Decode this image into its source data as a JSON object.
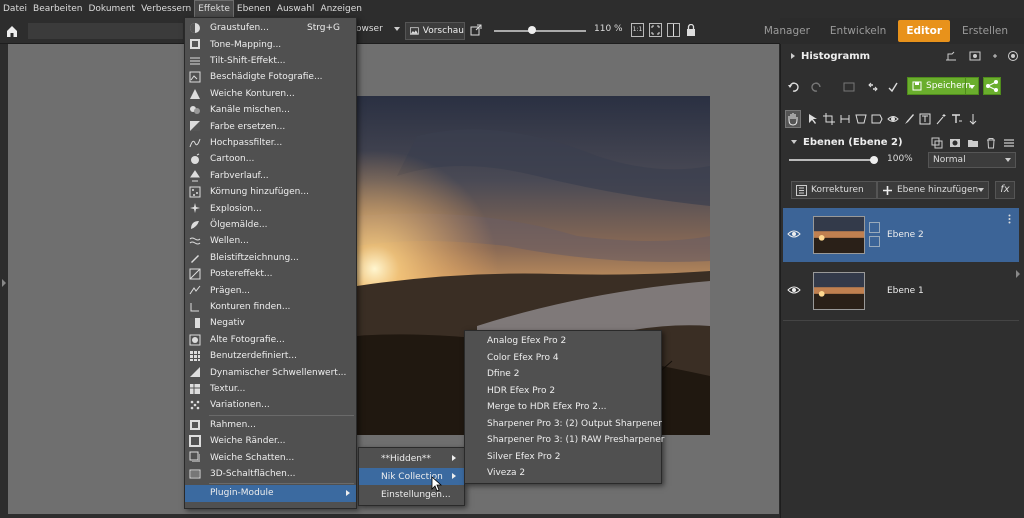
{
  "menubar": [
    "Datei",
    "Bearbeiten",
    "Dokument",
    "Verbessern",
    "Effekte",
    "Ebenen",
    "Auswahl",
    "Anzeigen"
  ],
  "menubar_active": "Effekte",
  "modes": [
    "Manager",
    "Entwickeln",
    "Editor",
    "Erstellen"
  ],
  "mode_active": "Editor",
  "toolbar": {
    "browser_label": "owser",
    "preview_label": "Vorschau",
    "zoom": "110 %",
    "fit_1_1": "1:1"
  },
  "effects_menu": {
    "items": [
      {
        "label": "Graustufen...",
        "shortcut": "Strg+G",
        "icon": "grayscale-icon"
      },
      {
        "label": "Tone-Mapping...",
        "icon": "tone-mapping-icon"
      },
      {
        "label": "Tilt-Shift-Effekt...",
        "icon": "tilt-shift-icon"
      },
      {
        "label": "Beschädigte Fotografie...",
        "icon": "damaged-photo-icon"
      },
      {
        "label": "Weiche Konturen...",
        "icon": "soft-contours-icon"
      },
      {
        "label": "Kanäle mischen...",
        "icon": "channel-mixer-icon"
      },
      {
        "label": "Farbe ersetzen...",
        "icon": "replace-color-icon"
      },
      {
        "label": "Hochpassfilter...",
        "icon": "highpass-icon"
      },
      {
        "label": "Cartoon...",
        "icon": "cartoon-icon"
      },
      {
        "label": "Farbverlauf...",
        "icon": "gradient-icon"
      },
      {
        "label": "Körnung hinzufügen...",
        "icon": "grain-icon"
      },
      {
        "label": "Explosion...",
        "icon": "explosion-icon"
      },
      {
        "label": "Ölgemälde...",
        "icon": "oil-painting-icon"
      },
      {
        "label": "Wellen...",
        "icon": "waves-icon"
      },
      {
        "label": "Bleistiftzeichnung...",
        "icon": "pencil-icon"
      },
      {
        "label": "Postereffekt...",
        "icon": "poster-icon"
      },
      {
        "label": "Prägen...",
        "icon": "emboss-icon"
      },
      {
        "label": "Konturen finden...",
        "icon": "find-edges-icon"
      },
      {
        "label": "Negativ",
        "icon": "negative-icon"
      },
      {
        "label": "Alte Fotografie...",
        "icon": "old-photo-icon"
      },
      {
        "label": "Benutzerdefiniert...",
        "icon": "custom-icon"
      },
      {
        "label": "Dynamischer Schwellenwert...",
        "icon": "threshold-icon"
      },
      {
        "label": "Textur...",
        "icon": "texture-icon"
      },
      {
        "label": "Variationen...",
        "icon": "variations-icon"
      },
      {
        "label": "Rahmen...",
        "icon": "frame-icon"
      },
      {
        "label": "Weiche Ränder...",
        "icon": "soft-edges-icon"
      },
      {
        "label": "Weiche Schatten...",
        "icon": "soft-shadow-icon"
      },
      {
        "label": "3D-Schaltflächen...",
        "icon": "3d-button-icon"
      },
      {
        "label": "Plugin-Module",
        "icon": "",
        "submenu": true,
        "highlighted": true
      }
    ]
  },
  "plugin_menu": {
    "items": [
      {
        "label": "**Hidden**",
        "submenu": true
      },
      {
        "label": "Nik Collection",
        "submenu": true,
        "highlighted": true
      },
      {
        "label": "Einstellungen..."
      }
    ]
  },
  "nik_menu": {
    "items": [
      "Analog Efex Pro 2",
      "Color Efex Pro 4",
      "Dfine 2",
      "HDR Efex Pro 2",
      "Merge to HDR Efex Pro 2...",
      "Sharpener Pro 3: (2) Output Sharpener",
      "Sharpener Pro 3: (1) RAW Presharpener",
      "Silver Efex Pro 2",
      "Viveza 2"
    ]
  },
  "right_panel": {
    "histogram_title": "Histogramm",
    "save_label": "Speichern",
    "layers_title": "Ebenen (Ebene 2)",
    "opacity": "100%",
    "opacity_fraction": 1.0,
    "blend_mode": "Normal",
    "corrections_label": "Korrekturen",
    "add_layer_label": "Ebene hinzufügen",
    "fx_label": "fx",
    "layers": [
      {
        "name": "Ebene 2",
        "selected": true
      },
      {
        "name": "Ebene 1",
        "selected": false
      }
    ]
  },
  "colors": {
    "accent": "#e8921b",
    "selection": "#3b6aa0",
    "save_green": "#6aae2d"
  }
}
